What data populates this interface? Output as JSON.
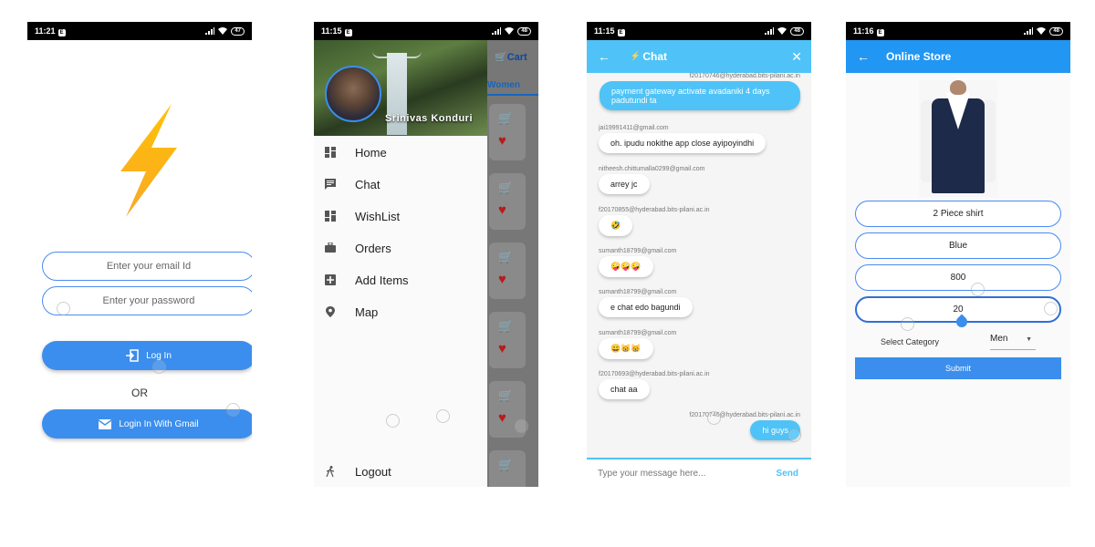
{
  "colors": {
    "accent": "#3b8eed",
    "chat_accent": "#4fc3f7",
    "store_bar": "#2196f3",
    "heart": "#b71c1c"
  },
  "screen1": {
    "status": {
      "time": "11:21",
      "battery": "47"
    },
    "logo_icon": "lightning-bolt-icon",
    "email_placeholder": "Enter your email Id",
    "password_placeholder": "Enter your password",
    "login_label": "Log In",
    "login_icon": "login-icon",
    "or_text": "OR",
    "gmail_label": "Login In With Gmail",
    "gmail_icon": "mail-icon"
  },
  "screen2": {
    "status": {
      "time": "11:15",
      "battery": "48"
    },
    "user_name": "Srinivas Konduri",
    "behind": {
      "cart_label": "Cart",
      "tab_label": "Women"
    },
    "menu": [
      {
        "label": "Home",
        "icon": "dashboard-icon"
      },
      {
        "label": "Chat",
        "icon": "chat-icon"
      },
      {
        "label": "WishList",
        "icon": "dashboard-icon"
      },
      {
        "label": "Orders",
        "icon": "briefcase-icon"
      },
      {
        "label": "Add Items",
        "icon": "add-box-icon"
      },
      {
        "label": "Map",
        "icon": "location-pin-icon"
      }
    ],
    "logout": {
      "label": "Logout",
      "icon": "walking-icon"
    }
  },
  "screen3": {
    "status": {
      "time": "11:15",
      "battery": "48"
    },
    "title": "Chat",
    "messages": [
      {
        "sender": "f20170746@hyderabad.bits-pilani.ac.in",
        "text": "payment gateway activate avadaniki 4 days padutundi ta",
        "mine": true
      },
      {
        "sender": "jai19991411@gmail.com",
        "text": "oh. ipudu nokithe app close ayipoyindhi",
        "mine": false
      },
      {
        "sender": "nitheesh.chittumalla0299@gmail.com",
        "text": "arrey jc",
        "mine": false
      },
      {
        "sender": "f20170855@hyderabad.bits-pilani.ac.in",
        "text": "🤣",
        "mine": false
      },
      {
        "sender": "sumanth18799@gmail.com",
        "text": "🤪🤪🤪",
        "mine": false
      },
      {
        "sender": "sumanth18799@gmail.com",
        "text": "e chat edo bagundi",
        "mine": false
      },
      {
        "sender": "sumanth18799@gmail.com",
        "text": "😄😸😸",
        "mine": false
      },
      {
        "sender": "f20170693@hyderabad.bits-pilani.ac.in",
        "text": "chat aa",
        "mine": false
      },
      {
        "sender": "f20170746@hyderabad.bits-pilani.ac.in",
        "text": "hi guys",
        "mine": true
      }
    ],
    "input_placeholder": "Type your message here...",
    "send_label": "Send"
  },
  "screen4": {
    "status": {
      "time": "11:16",
      "battery": "48"
    },
    "title": "Online Store",
    "fields": [
      "2 Piece shirt",
      "Blue",
      "800",
      "20"
    ],
    "category_label": "Select Category",
    "category_value": "Men",
    "submit_label": "Submit"
  }
}
